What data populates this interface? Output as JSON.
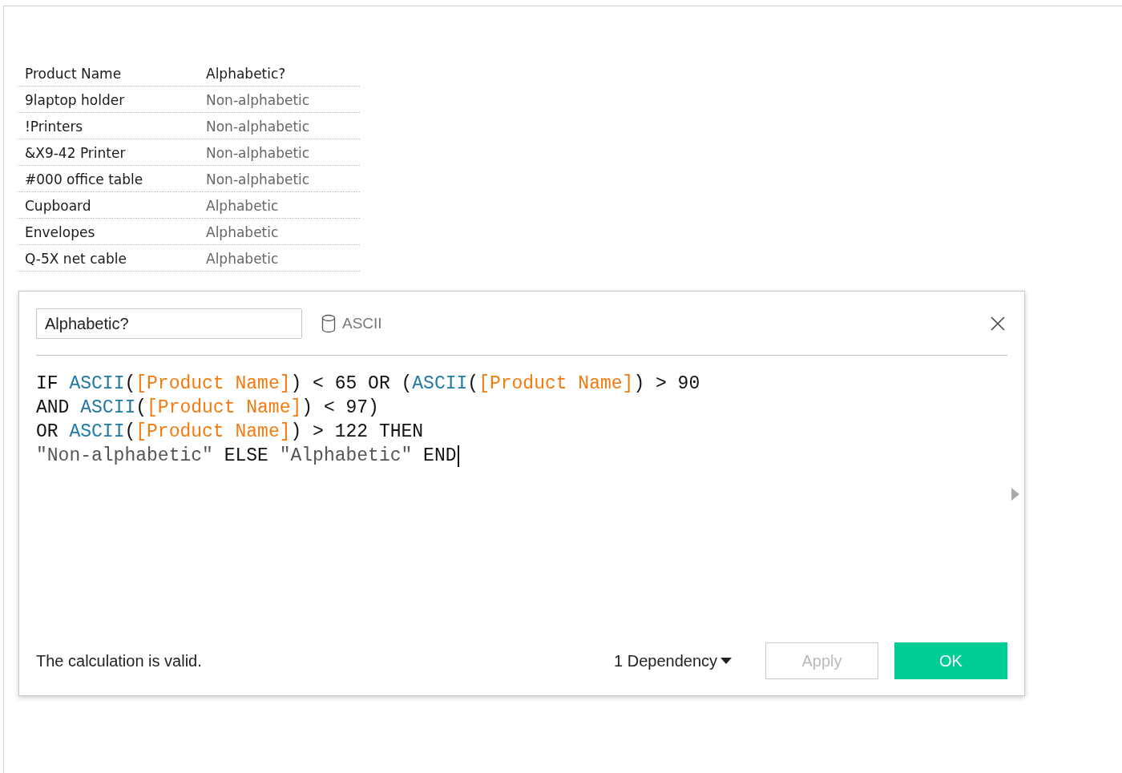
{
  "table": {
    "columns": [
      "Product Name",
      "Alphabetic?"
    ],
    "rows": [
      {
        "name": "9laptop holder",
        "value": "Non-alphabetic"
      },
      {
        "name": "!Printers",
        "value": "Non-alphabetic"
      },
      {
        "name": "&X9-42 Printer",
        "value": "Non-alphabetic"
      },
      {
        "name": "#000 office table",
        "value": "Non-alphabetic"
      },
      {
        "name": "Cupboard",
        "value": "Alphabetic"
      },
      {
        "name": "Envelopes",
        "value": "Alphabetic"
      },
      {
        "name": "Q-5X net cable",
        "value": "Alphabetic"
      }
    ]
  },
  "dialog": {
    "name_field": {
      "value": "Alphabetic?"
    },
    "data_source": "ASCII",
    "formula": [
      [
        {
          "kind": "keyword",
          "text": "IF "
        },
        {
          "kind": "function",
          "text": "ASCII"
        },
        {
          "kind": "keyword",
          "text": "("
        },
        {
          "kind": "field",
          "text": "[Product Name]"
        },
        {
          "kind": "keyword",
          "text": ") < 65 OR ("
        },
        {
          "kind": "function",
          "text": "ASCII"
        },
        {
          "kind": "keyword",
          "text": "("
        },
        {
          "kind": "field",
          "text": "[Product Name]"
        },
        {
          "kind": "keyword",
          "text": ") > 90"
        }
      ],
      [
        {
          "kind": "keyword",
          "text": "AND "
        },
        {
          "kind": "function",
          "text": "ASCII"
        },
        {
          "kind": "keyword",
          "text": "("
        },
        {
          "kind": "field",
          "text": "[Product Name]"
        },
        {
          "kind": "keyword",
          "text": ") < 97)"
        }
      ],
      [
        {
          "kind": "keyword",
          "text": "OR "
        },
        {
          "kind": "function",
          "text": "ASCII"
        },
        {
          "kind": "keyword",
          "text": "("
        },
        {
          "kind": "field",
          "text": "[Product Name]"
        },
        {
          "kind": "keyword",
          "text": ") > 122 THEN"
        }
      ],
      [
        {
          "kind": "string",
          "text": "\"Non-alphabetic\""
        },
        {
          "kind": "keyword",
          "text": " ELSE "
        },
        {
          "kind": "string",
          "text": "\"Alphabetic\""
        },
        {
          "kind": "keyword",
          "text": " END"
        }
      ]
    ],
    "status": "The calculation is valid.",
    "dependency": "1 Dependency",
    "buttons": [
      {
        "label": "Apply",
        "kind": "secondary",
        "disabled": true
      },
      {
        "label": "OK",
        "kind": "primary",
        "disabled": false
      }
    ]
  }
}
